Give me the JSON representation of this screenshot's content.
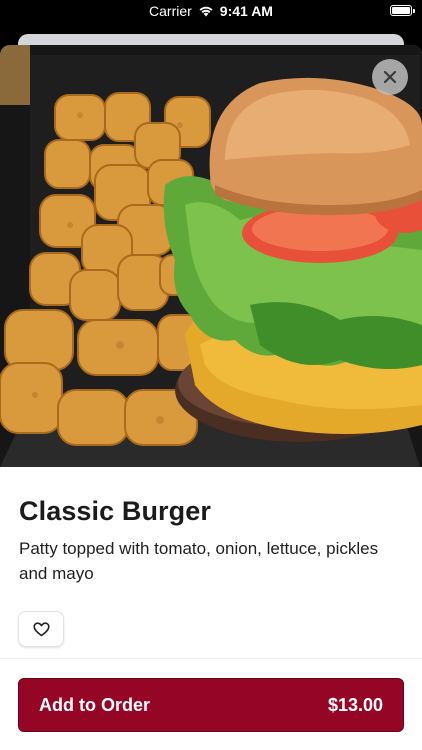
{
  "status_bar": {
    "carrier": "Carrier",
    "time": "9:41 AM",
    "icons": [
      "wifi-icon",
      "battery-icon"
    ]
  },
  "item": {
    "image_alt": "Classic Burger with tater tots",
    "name": "Classic Burger",
    "description": "Patty topped with tomato, onion, lettuce, pickles and mayo"
  },
  "actions": {
    "close_icon": "close-icon",
    "favorite_icon": "heart-icon",
    "add_label": "Add to Order",
    "price": "$13.00"
  },
  "colors": {
    "accent": "#950525",
    "text": "#1b1b1b"
  }
}
